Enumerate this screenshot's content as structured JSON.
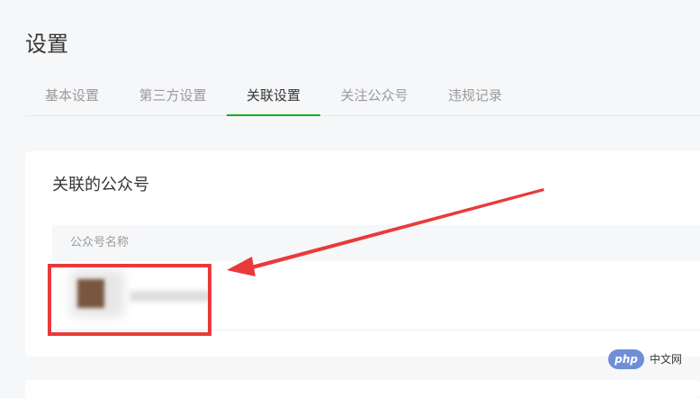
{
  "page": {
    "title": "设置"
  },
  "tabs": [
    {
      "label": "基本设置",
      "active": false
    },
    {
      "label": "第三方设置",
      "active": false
    },
    {
      "label": "关联设置",
      "active": true
    },
    {
      "label": "关注公众号",
      "active": false
    },
    {
      "label": "违规记录",
      "active": false
    }
  ],
  "linked_accounts": {
    "title": "关联的公众号",
    "columns": [
      "公众号名称"
    ]
  },
  "watermark": {
    "badge": "php",
    "text": "中文网"
  },
  "colors": {
    "accent": "#1aad19",
    "highlight": "#e93a3a"
  }
}
